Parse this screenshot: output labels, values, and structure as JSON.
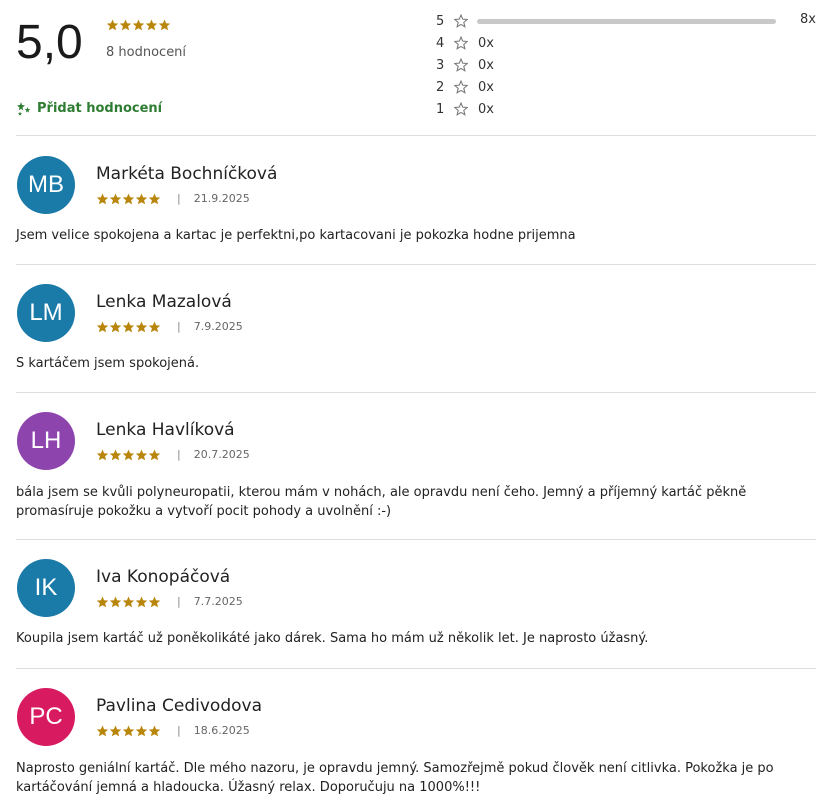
{
  "summary": {
    "score": "5,0",
    "stars": 5,
    "count_label": "8 hodnocení",
    "add_rating_label": "Přidat hodnocení"
  },
  "distribution": [
    {
      "stars": "5",
      "count": "8x",
      "fraction": 1.0
    },
    {
      "stars": "4",
      "count": "0x",
      "fraction": 0
    },
    {
      "stars": "3",
      "count": "0x",
      "fraction": 0
    },
    {
      "stars": "2",
      "count": "0x",
      "fraction": 0
    },
    {
      "stars": "1",
      "count": "0x",
      "fraction": 0
    }
  ],
  "reviews": [
    {
      "initials": "MB",
      "avatar_color": "#1a7aa8",
      "author": "Markéta Bochníčková",
      "stars": 5,
      "date": "21.9.2025",
      "text": "Jsem velice spokojena a kartac je perfektni,po kartacovani je pokozka hodne prijemna"
    },
    {
      "initials": "LM",
      "avatar_color": "#1a7aa8",
      "author": "Lenka Mazalová",
      "stars": 5,
      "date": "7.9.2025",
      "text": "S kartáčem jsem spokojená."
    },
    {
      "initials": "LH",
      "avatar_color": "#8e44ad",
      "author": "Lenka Havlíková",
      "stars": 5,
      "date": "20.7.2025",
      "text": "bála jsem se kvůli polyneuropatii, kterou mám v nohách, ale opravdu není čeho. Jemný a příjemný kartáč pěkně promasíruje pokožku a vytvoří pocit pohody a uvolnění :-)"
    },
    {
      "initials": "IK",
      "avatar_color": "#1a7aa8",
      "author": "Iva Konopáčová",
      "stars": 5,
      "date": "7.7.2025",
      "text": "Koupila jsem kartáč už poněkolikáté jako dárek. Sama ho mám už několik let. Je naprosto úžasný."
    },
    {
      "initials": "PC",
      "avatar_color": "#d81b60",
      "author": "Pavlina Cedivodova",
      "stars": 5,
      "date": "18.6.2025",
      "text": "Naprosto geniální kartáč. Dle mého nazoru, je opravdu jemný. Samozřejmě pokud člověk není citlivka. Pokožka je po kartáčování jemná a hladoucka. Úžasný relax. Doporučuju na 1000%!!!"
    }
  ],
  "colors": {
    "star": "#b8860b",
    "accent_green": "#2e7d32",
    "divider": "#dddddd"
  },
  "icons": {
    "rating_star": "filled-star-icon",
    "empty_star": "outline-star-icon",
    "add_rating": "sparkle-stars-icon"
  }
}
